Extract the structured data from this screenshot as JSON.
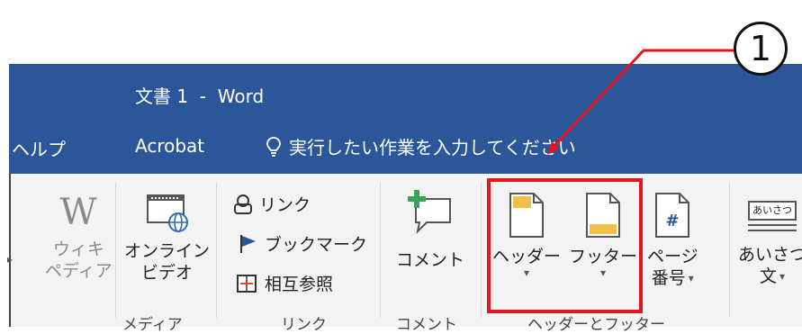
{
  "window": {
    "title": "文書 1  -  Word"
  },
  "menu": {
    "help": "ヘルプ",
    "acrobat": "Acrobat",
    "tell_me": "実行したい作業を入力してください"
  },
  "ribbon": {
    "wiki": {
      "line1": "ウィキ",
      "line2": "ペディア"
    },
    "online_video": {
      "line1": "オンライン",
      "line2": "ビデオ"
    },
    "link": "リンク",
    "bookmark": "ブックマーク",
    "cross_ref": "相互参照",
    "comment": "コメント",
    "header": "ヘッダー",
    "footer": "フッター",
    "page_number": {
      "line1": "ページ",
      "line2": "番号"
    },
    "greeting": {
      "line1": "あいさつ",
      "line2": "文"
    },
    "greeting_icon_text": "あいさつ",
    "caret": "▾",
    "groups": {
      "media": "メディア",
      "links": "リンク",
      "comments": "コメント",
      "header_footer": "ヘッダーとフッター"
    }
  },
  "annotation": {
    "number": "1"
  },
  "colors": {
    "title_bar": "#2b579a",
    "highlight": "#e8141b",
    "ribbon": "#f3f3f3"
  }
}
